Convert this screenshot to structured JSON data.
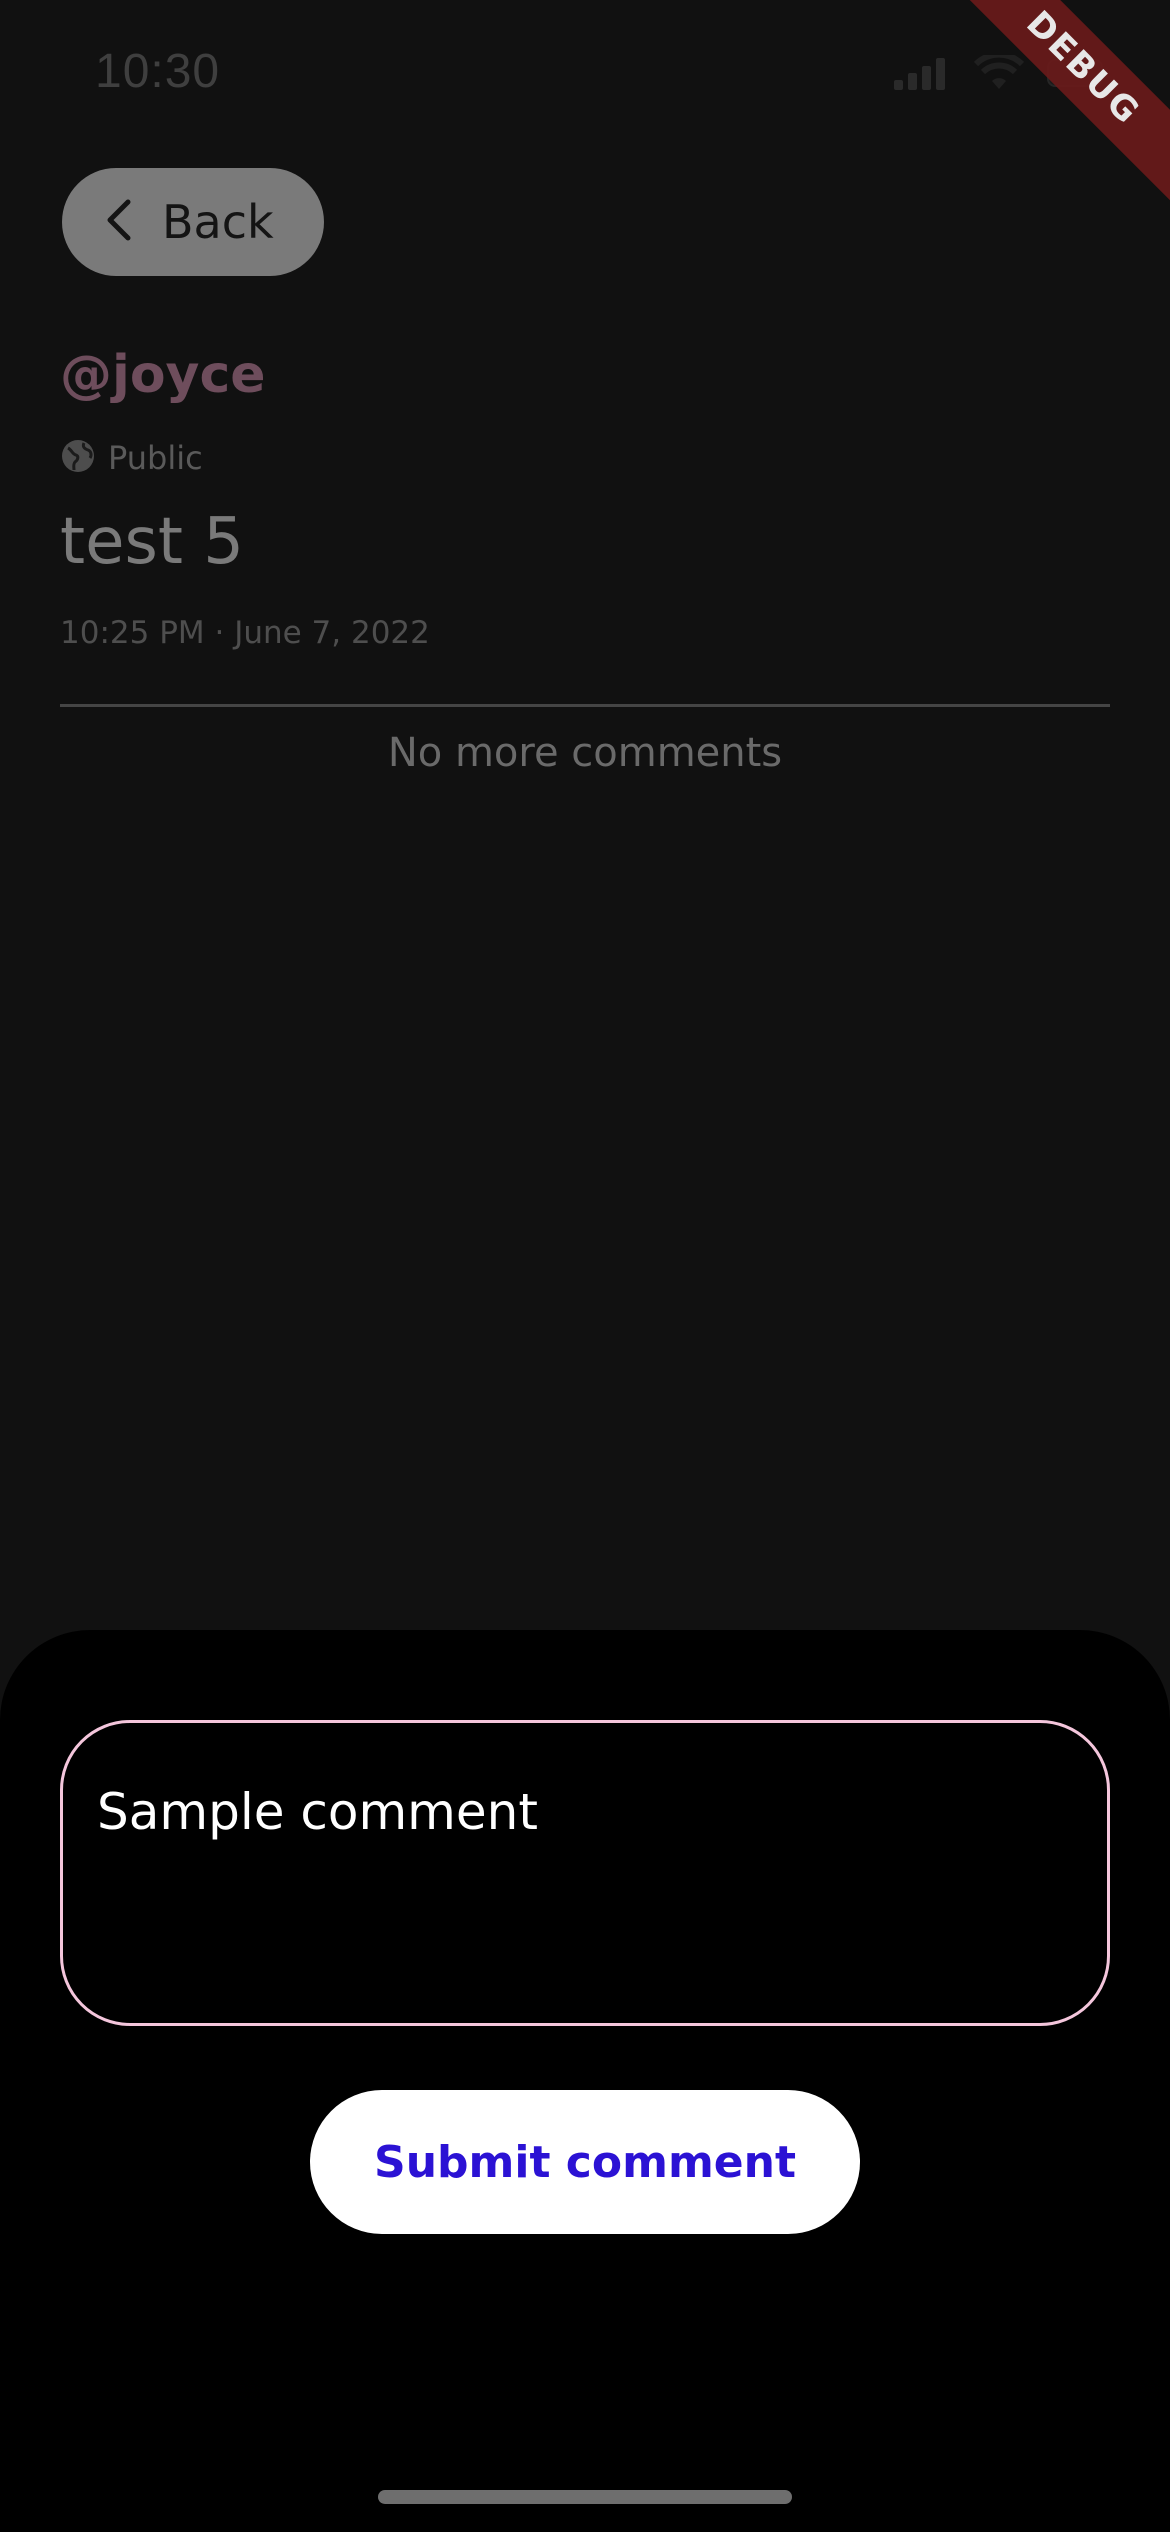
{
  "status_bar": {
    "time": "10:30"
  },
  "debug_banner": {
    "label": "DEBUG"
  },
  "nav": {
    "back_label": "Back"
  },
  "post": {
    "handle": "@joyce",
    "visibility": "Public",
    "title": "test 5",
    "timestamp": "10:25 PM · June 7, 2022"
  },
  "comments": {
    "empty_text": "No more comments"
  },
  "composer": {
    "input_value": "Sample comment",
    "submit_label": "Submit comment"
  },
  "icons": {
    "back": "chevron-left-icon",
    "globe": "globe-icon",
    "wifi": "wifi-icon",
    "battery": "battery-icon",
    "signal": "cellular-signal-icon"
  },
  "colors": {
    "background": "#111111",
    "sheet": "#000000",
    "handle": "#6e4d5c",
    "input_border": "#f4c6dc",
    "submit_text": "#2b12d4",
    "debug_ribbon": "#6b1a1a"
  }
}
